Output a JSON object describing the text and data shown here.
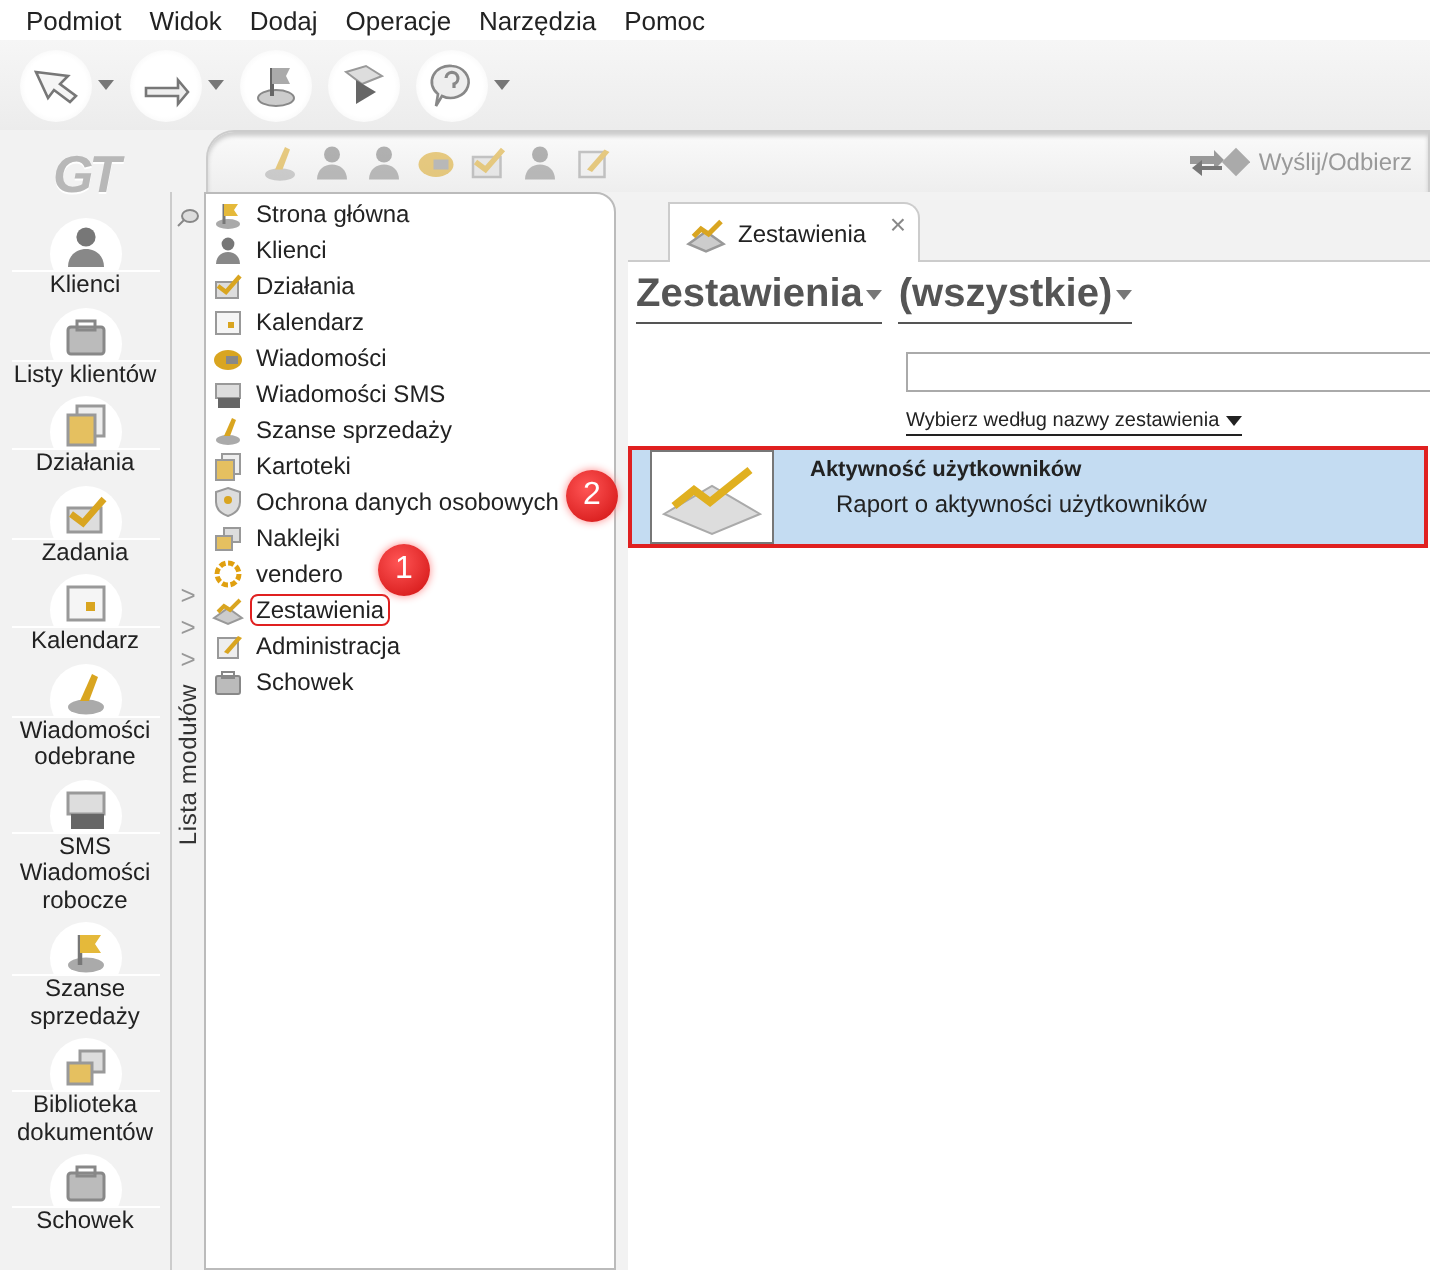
{
  "menu": [
    {
      "label": "Podmiot"
    },
    {
      "label": "Widok"
    },
    {
      "label": "Dodaj"
    },
    {
      "label": "Operacje"
    },
    {
      "label": "Narzędzia"
    },
    {
      "label": "Pomoc"
    }
  ],
  "toolbar": [
    {
      "has_menu": true
    },
    {
      "has_menu": true
    },
    {
      "has_menu": false
    },
    {
      "has_menu": false
    },
    {
      "has_menu": true
    }
  ],
  "logo": "GT",
  "nav_items": [
    {
      "label": "Klienci"
    },
    {
      "label": "Listy klientów"
    },
    {
      "label": "Działania"
    },
    {
      "label": "Zadania"
    },
    {
      "label": "Kalendarz"
    },
    {
      "label": "Wiadomości odebrane"
    },
    {
      "label": "SMS Wiadomości robocze"
    },
    {
      "label": "Szanse sprzedaży"
    },
    {
      "label": "Biblioteka dokumentów"
    },
    {
      "label": "Schowek"
    }
  ],
  "module_toolbar": {
    "send_receive": {
      "label": "Wyślij/Odbierz",
      "disabled": true
    }
  },
  "module_panel": {
    "title": "Lista modułów",
    "expanders": [
      ">",
      ">",
      ">"
    ],
    "items": [
      {
        "label": "Strona główna",
        "highlighted": false
      },
      {
        "label": "Klienci",
        "highlighted": false
      },
      {
        "label": "Działania",
        "highlighted": false
      },
      {
        "label": "Kalendarz",
        "highlighted": false
      },
      {
        "label": "Wiadomości",
        "highlighted": false
      },
      {
        "label": "Wiadomości SMS",
        "highlighted": false
      },
      {
        "label": "Szanse sprzedaży",
        "highlighted": false
      },
      {
        "label": "Kartoteki",
        "highlighted": false
      },
      {
        "label": "Ochrona danych osobowych",
        "highlighted": false
      },
      {
        "label": "Naklejki",
        "highlighted": false
      },
      {
        "label": "vendero",
        "highlighted": false
      },
      {
        "label": "Zestawienia",
        "highlighted": true,
        "badge": "1"
      },
      {
        "label": "Administracja",
        "highlighted": false
      },
      {
        "label": "Schowek",
        "highlighted": false
      }
    ]
  },
  "tab": {
    "label": "Zestawienia",
    "close": "×",
    "selected": true
  },
  "heading": {
    "category": "Zestawienia",
    "filter": "(wszystkie)"
  },
  "sort_link": "Wybierz według nazwy zestawienia",
  "reports": [
    {
      "title": "Aktywność użytkowników",
      "description": "Raport o aktywności użytkowników",
      "selected": true,
      "highlighted": true,
      "badge": "2"
    }
  ]
}
